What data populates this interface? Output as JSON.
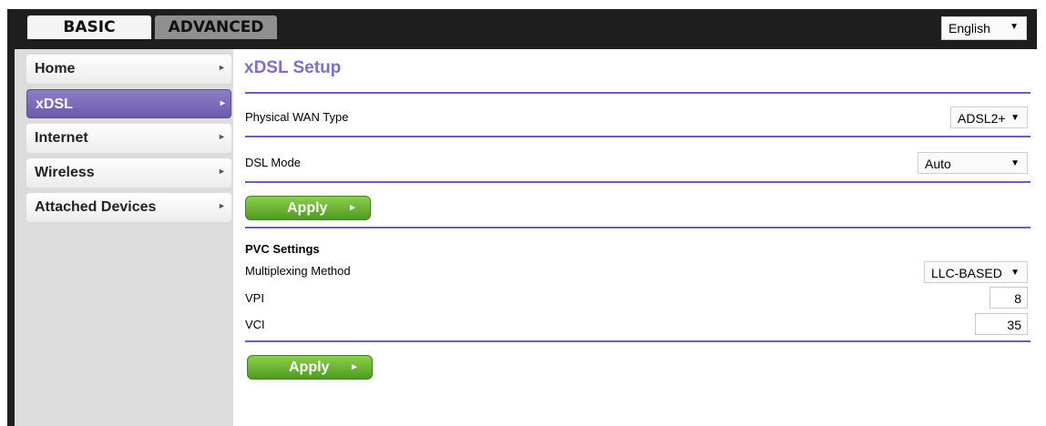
{
  "tabs": {
    "basic": "BASIC",
    "advanced": "ADVANCED"
  },
  "language": {
    "selected": "English"
  },
  "sidebar": {
    "items": [
      {
        "label": "Home"
      },
      {
        "label": "xDSL"
      },
      {
        "label": "Internet"
      },
      {
        "label": "Wireless"
      },
      {
        "label": "Attached Devices"
      }
    ]
  },
  "page": {
    "title": "xDSL Setup"
  },
  "form": {
    "physical_wan_type": {
      "label": "Physical WAN Type",
      "value": "ADSL2+"
    },
    "dsl_mode": {
      "label": "DSL Mode",
      "value": "Auto"
    },
    "apply": "Apply",
    "pvc": {
      "heading": "PVC Settings",
      "multiplexing": {
        "label": "Multiplexing Method",
        "value": "LLC-BASED"
      },
      "vpi": {
        "label": "VPI",
        "value": "8"
      },
      "vci": {
        "label": "VCI",
        "value": "35"
      }
    }
  },
  "colors": {
    "accent": "#6a5cc0",
    "title": "#7a70cc",
    "apply_green": "#5aa82a"
  },
  "icons": {
    "dropdown": "triangle-down-icon",
    "chevron": "chevron-right-icon"
  }
}
